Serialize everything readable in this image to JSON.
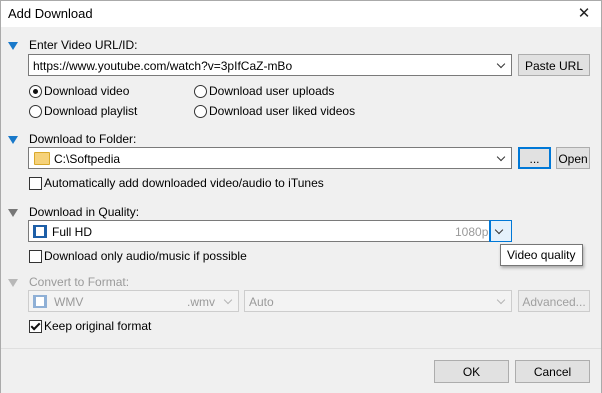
{
  "window": {
    "title": "Add Download",
    "close_glyph": "✕"
  },
  "url_section": {
    "heading": "Enter Video URL/ID:",
    "url_value": "https://www.youtube.com/watch?v=3pIfCaZ-mBo",
    "paste_button": "Paste URL",
    "options": [
      {
        "label": "Download video",
        "selected": true
      },
      {
        "label": "Download playlist",
        "selected": false
      },
      {
        "label": "Download user uploads",
        "selected": false
      },
      {
        "label": "Download user liked videos",
        "selected": false
      }
    ]
  },
  "folder_section": {
    "heading": "Download to Folder:",
    "path": "C:\\Softpedia",
    "browse_button": "...",
    "open_button": "Open",
    "itunes_checkbox": {
      "label": "Automatically add downloaded video/audio to iTunes",
      "checked": false
    }
  },
  "quality_section": {
    "heading": "Download in Quality:",
    "quality_name": "Full HD",
    "quality_res": "1080p",
    "tooltip": "Video quality",
    "audio_only_checkbox": {
      "label": "Download only audio/music if possible",
      "checked": false
    }
  },
  "format_section": {
    "heading": "Convert to Format:",
    "format_name": "WMV",
    "format_ext": ".wmv",
    "preset": "Auto",
    "advanced_button": "Advanced...",
    "keep_original_checkbox": {
      "label": "Keep original format",
      "checked": true
    }
  },
  "footer": {
    "ok_button": "OK",
    "cancel_button": "Cancel"
  },
  "colors": {
    "accent": "#1979ca",
    "focus": "#0078d7",
    "disabled_text": "#9a9a9a"
  }
}
